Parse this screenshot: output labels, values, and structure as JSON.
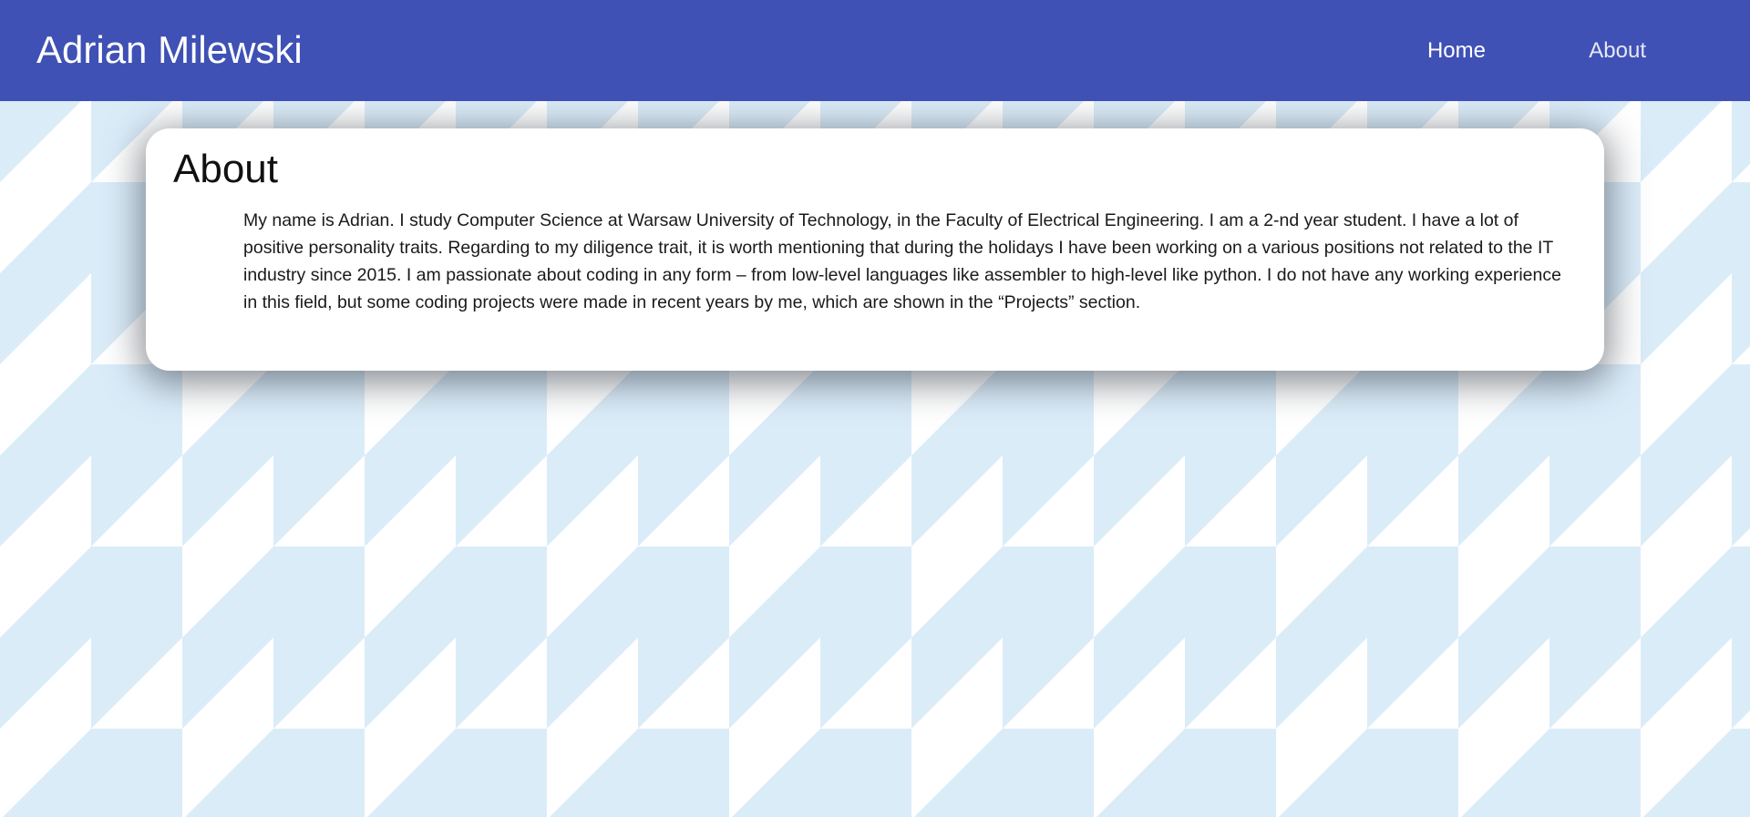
{
  "header": {
    "site_title": "Adrian Milewski",
    "nav": {
      "home_label": "Home",
      "about_label": "About"
    }
  },
  "main": {
    "section_title": "About",
    "bio_text": "My name is Adrian. I study Computer Science at Warsaw University of Technology, in the Faculty of Electrical Engineering. I am a 2-nd year student. I have a lot of positive personality traits. Regarding to my diligence trait, it is worth mentioning that during the holidays I have been working on a various positions not related to the IT industry since 2015. I am passionate about coding in any form – from low-level languages like assembler to high-level like python. I do not have any working experience in this field, but some coding projects were made in recent years by me, which are shown in the “Projects” section."
  },
  "colors": {
    "header_bg": "#3f51b5",
    "pattern": "#dbecf9",
    "card_bg": "#ffffff"
  }
}
